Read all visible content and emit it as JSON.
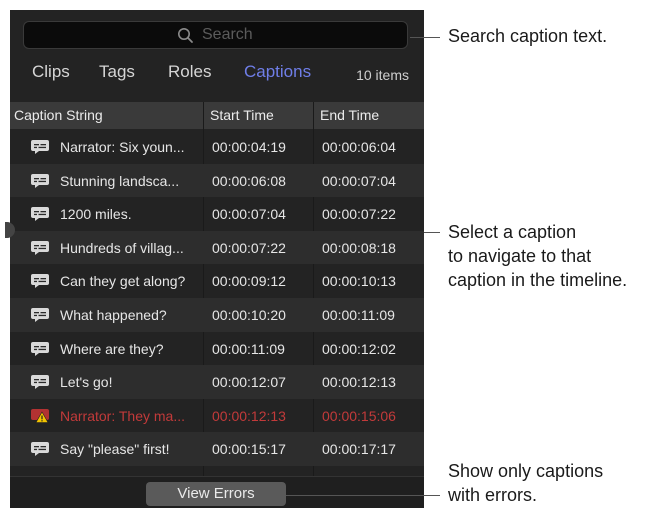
{
  "search": {
    "placeholder": "Search"
  },
  "tabs": [
    {
      "label": "Clips"
    },
    {
      "label": "Tags"
    },
    {
      "label": "Roles"
    },
    {
      "label": "Captions",
      "active": true
    }
  ],
  "item_count": "10 items",
  "columns": [
    "Caption String",
    "Start Time",
    "End Time"
  ],
  "rows": [
    {
      "caption": "Narrator: Six youn...",
      "start": "00:00:04:19",
      "end": "00:00:06:04",
      "error": false,
      "icon": "caption-icon"
    },
    {
      "caption": "Stunning landsca...",
      "start": "00:00:06:08",
      "end": "00:00:07:04",
      "error": false,
      "icon": "caption-icon"
    },
    {
      "caption": "1200 miles.",
      "start": "00:00:07:04",
      "end": "00:00:07:22",
      "error": false,
      "icon": "caption-icon"
    },
    {
      "caption": "Hundreds of villag...",
      "start": "00:00:07:22",
      "end": "00:00:08:18",
      "error": false,
      "icon": "caption-icon"
    },
    {
      "caption": "Can they get along?",
      "start": "00:00:09:12",
      "end": "00:00:10:13",
      "error": false,
      "icon": "caption-icon"
    },
    {
      "caption": "What happened?",
      "start": "00:00:10:20",
      "end": "00:00:11:09",
      "error": false,
      "icon": "caption-icon"
    },
    {
      "caption": "Where are they?",
      "start": "00:00:11:09",
      "end": "00:00:12:02",
      "error": false,
      "icon": "caption-icon"
    },
    {
      "caption": "Let's go!",
      "start": "00:00:12:07",
      "end": "00:00:12:13",
      "error": false,
      "icon": "caption-icon"
    },
    {
      "caption": "Narrator: They ma...",
      "start": "00:00:12:13",
      "end": "00:00:15:06",
      "error": true,
      "icon": "caption-error-icon"
    },
    {
      "caption": "Say \"please\" first!",
      "start": "00:00:15:17",
      "end": "00:00:17:17",
      "error": false,
      "icon": "caption-icon"
    }
  ],
  "view_errors_label": "View Errors",
  "callouts": {
    "search": [
      "Search caption text."
    ],
    "select": [
      "Select a caption",
      "to navigate to that",
      "caption in the timeline."
    ],
    "errors": [
      "Show only captions",
      "with errors."
    ]
  },
  "colors": {
    "accent": "#6f7ee8",
    "error": "#c23a3a",
    "panel_bg": "#232323"
  }
}
